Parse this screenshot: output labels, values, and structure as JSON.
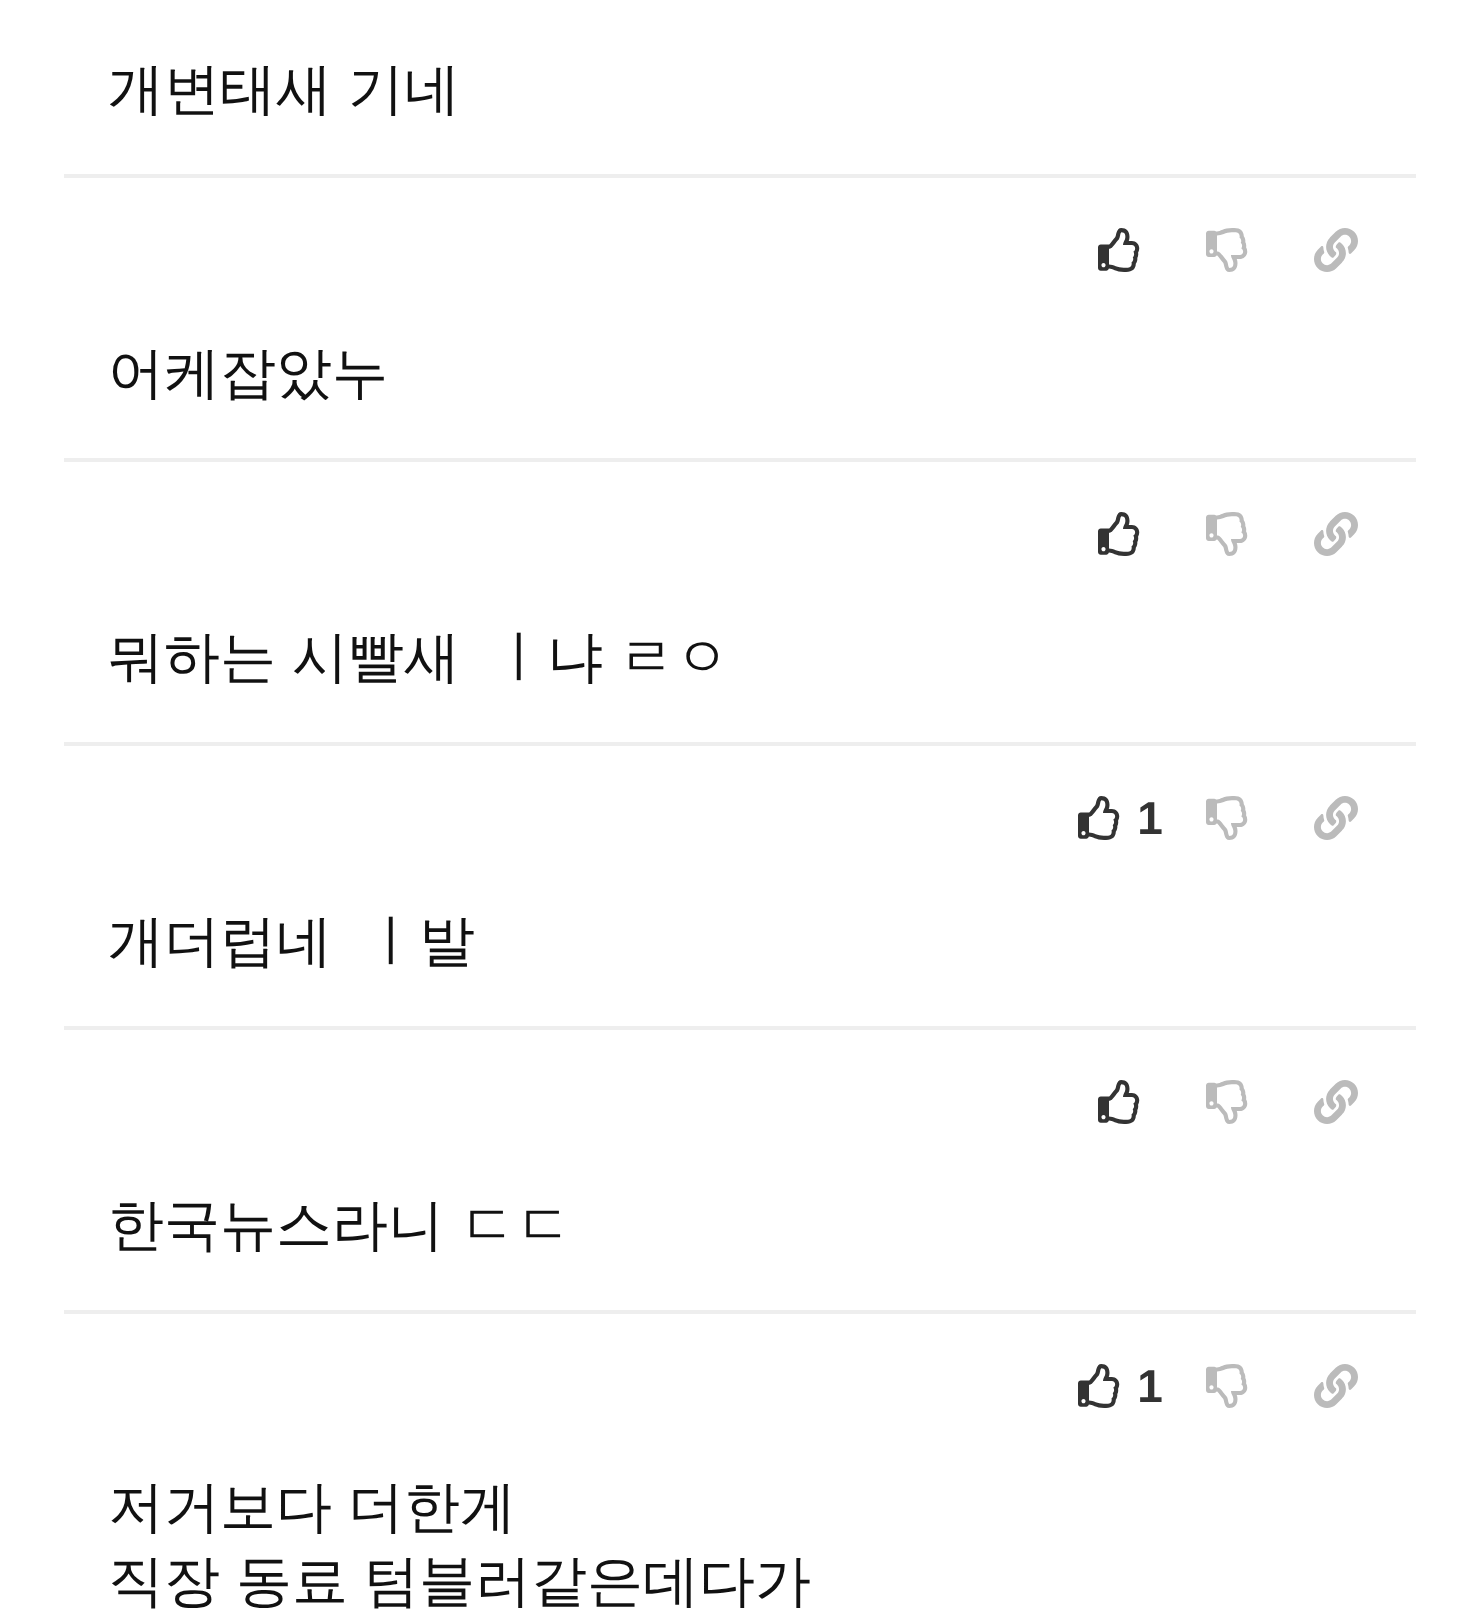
{
  "partial_comment": {
    "text": "개변태새 기네"
  },
  "comments": [
    {
      "text": "어케잡았누"
    },
    {
      "text": "뭐하는 시빨새  ㅣ냐 ㄹㅇ"
    },
    {
      "like_count": "1",
      "text": "개더럽네  ㅣ발"
    },
    {
      "text": "한국뉴스라니 ㄷㄷ"
    },
    {
      "like_count": "1",
      "text": "저거보다 더한게\n직장 동료 텀블러같은데다가"
    }
  ]
}
